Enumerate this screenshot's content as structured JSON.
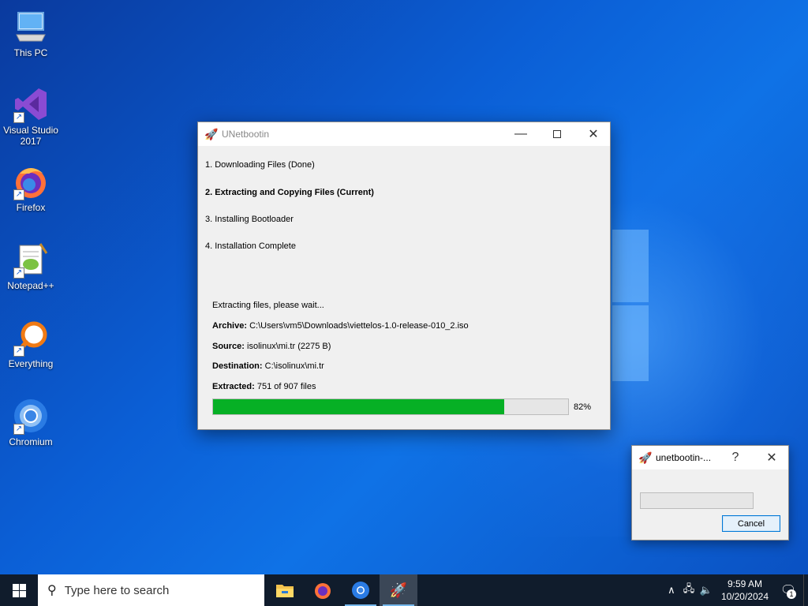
{
  "desktop": {
    "icons": [
      {
        "label": "This PC",
        "icon": "computer-icon"
      },
      {
        "label": "Visual Studio 2017",
        "icon": "visual-studio-icon"
      },
      {
        "label": "Firefox",
        "icon": "firefox-icon"
      },
      {
        "label": "Notepad++",
        "icon": "notepad-plus-plus-icon"
      },
      {
        "label": "Everything",
        "icon": "everything-search-icon"
      },
      {
        "label": "Chromium",
        "icon": "chromium-icon"
      }
    ]
  },
  "main_window": {
    "title": "UNetbootin",
    "steps": [
      {
        "text": "1. Downloading Files (Done)",
        "current": false
      },
      {
        "text": "2. Extracting and Copying Files (Current)",
        "current": true
      },
      {
        "text": "3. Installing Bootloader",
        "current": false
      },
      {
        "text": "4. Installation Complete",
        "current": false
      }
    ],
    "status_line": "Extracting files, please wait...",
    "archive_label": "Archive:",
    "archive_value": "C:\\Users\\vm5\\Downloads\\viettelos-1.0-release-010_2.iso",
    "source_label": "Source:",
    "source_value": "isolinux\\mi.tr (2275 B)",
    "destination_label": "Destination:",
    "destination_value": "C:\\isolinux\\mi.tr",
    "extracted_label": "Extracted:",
    "extracted_value": "751 of 907 files",
    "progress_percent": 82,
    "progress_text": "82%"
  },
  "dialog": {
    "title": "unetbootin-...",
    "help_label": "?",
    "cancel_label": "Cancel",
    "progress_percent": 0
  },
  "taskbar": {
    "search_placeholder": "Type here to search",
    "apps": [
      "file-explorer-icon",
      "firefox-icon",
      "chromium-icon",
      "unetbootin-icon"
    ],
    "active_app": "unetbootin-icon",
    "time": "9:59 AM",
    "date": "10/20/2024",
    "notification_count": "1"
  },
  "colors": {
    "progress_fill": "#06b025",
    "taskbar": "#101c2c",
    "desktop_blue": "#0b5fd6"
  }
}
